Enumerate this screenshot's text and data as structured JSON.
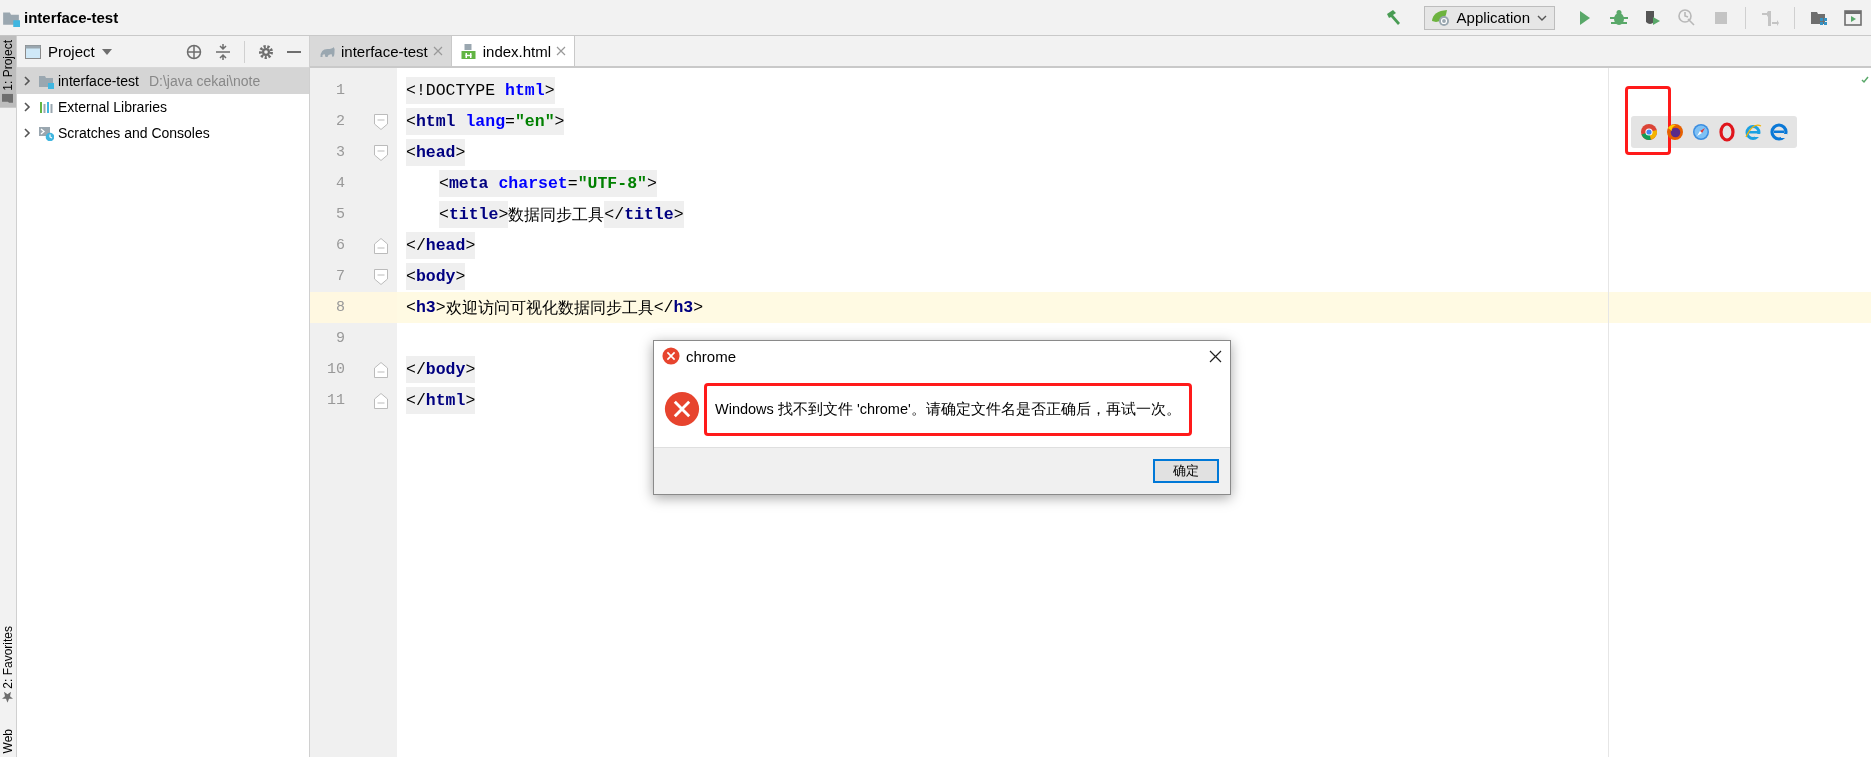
{
  "window": {
    "title": "interface-test"
  },
  "toolbar": {
    "run_config": "Application",
    "buttons": [
      {
        "kind": "build",
        "disabled": false
      },
      {
        "kind": "run",
        "disabled": false
      },
      {
        "kind": "debug",
        "disabled": false
      },
      {
        "kind": "coverage",
        "disabled": false
      },
      {
        "kind": "profile",
        "disabled": true
      },
      {
        "kind": "stop",
        "disabled": true
      },
      {
        "kind": "step",
        "disabled": true
      },
      {
        "kind": "structure",
        "disabled": false
      },
      {
        "kind": "run-window",
        "disabled": false
      }
    ]
  },
  "side_stripe": {
    "tabs": [
      {
        "label": "1: Project",
        "kind": "project",
        "selected": true
      },
      {
        "label": "2: Favorites",
        "kind": "favorites",
        "selected": false
      },
      {
        "label": "Web",
        "kind": "web",
        "selected": false
      }
    ]
  },
  "project_panel": {
    "title": "Project",
    "tree": [
      {
        "label": "interface-test",
        "path": "D:\\java cekai\\note",
        "kind": "module",
        "selected": true,
        "expanded": false
      },
      {
        "label": "External Libraries",
        "kind": "libraries",
        "selected": false,
        "expanded": false
      },
      {
        "label": "Scratches and Consoles",
        "kind": "scratches",
        "selected": false,
        "expanded": false
      }
    ]
  },
  "editor": {
    "tabs": [
      {
        "label": "interface-test",
        "kind": "gradle",
        "selected": false
      },
      {
        "label": "index.html",
        "kind": "html",
        "selected": true
      }
    ],
    "lines": [
      {
        "number": "1",
        "fold_start": false,
        "fold_end": false,
        "indented": false,
        "current": false,
        "segments": [
          {
            "kind": "punct",
            "text": "<!DOCTYPE "
          },
          {
            "kind": "attr",
            "text": "html"
          },
          {
            "kind": "punct",
            "text": ">"
          }
        ]
      },
      {
        "number": "2",
        "fold_start": true,
        "fold_end": false,
        "indented": false,
        "current": false,
        "segments": [
          {
            "kind": "punct",
            "text": "<"
          },
          {
            "kind": "tag",
            "text": "html "
          },
          {
            "kind": "attr",
            "text": "lang"
          },
          {
            "kind": "punct",
            "text": "="
          },
          {
            "kind": "value",
            "text": "\"en\""
          },
          {
            "kind": "punct",
            "text": ">"
          }
        ]
      },
      {
        "number": "3",
        "fold_start": true,
        "fold_end": false,
        "indented": false,
        "current": false,
        "segments": [
          {
            "kind": "punct",
            "text": "<"
          },
          {
            "kind": "tag",
            "text": "head"
          },
          {
            "kind": "punct",
            "text": ">"
          }
        ]
      },
      {
        "number": "4",
        "fold_start": false,
        "fold_end": false,
        "indented": true,
        "current": false,
        "segments": [
          {
            "kind": "punct",
            "text": "<"
          },
          {
            "kind": "tag",
            "text": "meta "
          },
          {
            "kind": "attr",
            "text": "charset"
          },
          {
            "kind": "punct",
            "text": "="
          },
          {
            "kind": "value",
            "text": "\"UTF-8\""
          },
          {
            "kind": "punct",
            "text": ">"
          }
        ]
      },
      {
        "number": "5",
        "fold_start": false,
        "fold_end": false,
        "indented": true,
        "current": false,
        "segments": [
          {
            "kind": "punct",
            "text": "<"
          },
          {
            "kind": "tag",
            "text": "title"
          },
          {
            "kind": "punct",
            "text": ">"
          },
          {
            "kind": "text",
            "text": "数据同步工具"
          },
          {
            "kind": "punct",
            "text": "</"
          },
          {
            "kind": "tag",
            "text": "title"
          },
          {
            "kind": "punct",
            "text": ">"
          }
        ]
      },
      {
        "number": "6",
        "fold_start": false,
        "fold_end": true,
        "indented": false,
        "current": false,
        "segments": [
          {
            "kind": "punct",
            "text": "</"
          },
          {
            "kind": "tag",
            "text": "head"
          },
          {
            "kind": "punct",
            "text": ">"
          }
        ]
      },
      {
        "number": "7",
        "fold_start": true,
        "fold_end": false,
        "indented": false,
        "current": false,
        "segments": [
          {
            "kind": "punct",
            "text": "<"
          },
          {
            "kind": "tag",
            "text": "body"
          },
          {
            "kind": "punct",
            "text": ">"
          }
        ]
      },
      {
        "number": "8",
        "fold_start": false,
        "fold_end": false,
        "indented": false,
        "current": true,
        "segments": [
          {
            "kind": "punct",
            "text": "<"
          },
          {
            "kind": "tag",
            "text": "h3"
          },
          {
            "kind": "punct",
            "text": ">"
          },
          {
            "kind": "text",
            "text": "欢迎访问可视化数据同步工具"
          },
          {
            "kind": "punct",
            "text": "</"
          },
          {
            "kind": "tag",
            "text": "h3"
          },
          {
            "kind": "punct",
            "text": ">"
          }
        ]
      },
      {
        "number": "9",
        "fold_start": false,
        "fold_end": false,
        "current": false
      },
      {
        "number": "10",
        "fold_start": false,
        "fold_end": true,
        "indented": false,
        "current": false,
        "segments": [
          {
            "kind": "punct",
            "text": "</"
          },
          {
            "kind": "tag",
            "text": "body"
          },
          {
            "kind": "punct",
            "text": ">"
          }
        ]
      },
      {
        "number": "11",
        "fold_start": false,
        "fold_end": true,
        "indented": false,
        "current": false,
        "segments": [
          {
            "kind": "punct",
            "text": "</"
          },
          {
            "kind": "tag",
            "text": "html"
          },
          {
            "kind": "punct",
            "text": ">"
          }
        ]
      }
    ],
    "browsers": [
      {
        "kind": "chrome",
        "selected": true
      },
      {
        "kind": "firefox",
        "selected": false
      },
      {
        "kind": "safari",
        "selected": false
      },
      {
        "kind": "opera",
        "selected": false
      },
      {
        "kind": "ie",
        "selected": false
      },
      {
        "kind": "edge",
        "selected": false
      }
    ]
  },
  "dialog": {
    "title": "chrome",
    "message": "Windows 找不到文件 'chrome'。请确定文件名是否正确后，再试一次。",
    "highlighted": true,
    "buttons": [
      {
        "label": "确定",
        "focused": true
      }
    ]
  }
}
